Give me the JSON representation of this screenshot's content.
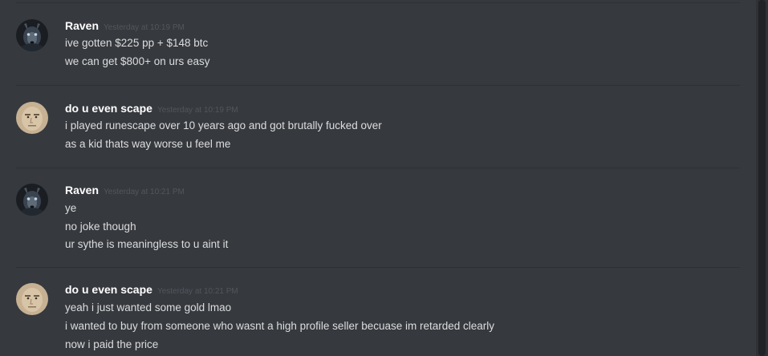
{
  "messages": [
    {
      "username": "Raven",
      "timestamp": "Yesterday at 10:19 PM",
      "avatar": "dark-wolf-avatar",
      "lines": [
        "ive gotten $225 pp + $148 btc",
        "we can get $800+ on urs easy"
      ]
    },
    {
      "username": "do u even scape",
      "timestamp": "Yesterday at 10:19 PM",
      "avatar": "beige-face-avatar",
      "lines": [
        "i played runescape over 10 years ago and got brutally fucked over",
        "as a kid thats way worse u feel me"
      ]
    },
    {
      "username": "Raven",
      "timestamp": "Yesterday at 10:21 PM",
      "avatar": "dark-wolf-avatar",
      "lines": [
        "ye",
        "no joke though",
        "ur sythe is meaningless to u aint it"
      ]
    },
    {
      "username": "do u even scape",
      "timestamp": "Yesterday at 10:21 PM",
      "avatar": "beige-face-avatar",
      "lines": [
        "yeah i just wanted some gold lmao",
        "i wanted to buy from someone who wasnt a high profile seller becuase im retarded clearly",
        "now i paid the price"
      ]
    }
  ],
  "colors": {
    "background": "#36393e",
    "username": "#ffffff",
    "text": "#dcddde",
    "timestamp": "#53565c",
    "divider": "#2e3035"
  }
}
